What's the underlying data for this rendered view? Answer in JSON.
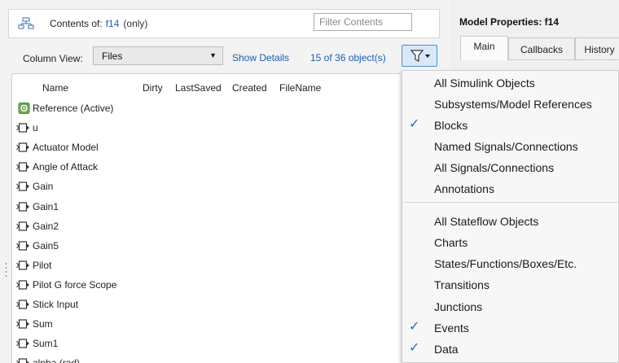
{
  "contents": {
    "label": "Contents of:",
    "model": "f14",
    "scope": "(only)",
    "filter_placeholder": "Filter Contents"
  },
  "toolbar": {
    "column_view_label": "Column View:",
    "column_view_value": "Files",
    "show_details": "Show Details",
    "object_count": "15 of 36 object(s)"
  },
  "columns": [
    "Name",
    "Dirty",
    "LastSaved",
    "Created",
    "FileName"
  ],
  "rows": [
    {
      "name": "Reference (Active)",
      "icon": "reference-icon"
    },
    {
      "name": "u",
      "icon": "block-icon"
    },
    {
      "name": "Actuator Model",
      "icon": "block-icon"
    },
    {
      "name": "Angle of  Attack",
      "icon": "block-icon"
    },
    {
      "name": "Gain",
      "icon": "block-icon"
    },
    {
      "name": "Gain1",
      "icon": "block-icon"
    },
    {
      "name": "Gain2",
      "icon": "block-icon"
    },
    {
      "name": "Gain5",
      "icon": "block-icon"
    },
    {
      "name": "Pilot",
      "icon": "block-icon"
    },
    {
      "name": "Pilot G force Scope",
      "icon": "block-icon"
    },
    {
      "name": "Stick Input",
      "icon": "block-icon"
    },
    {
      "name": "Sum",
      "icon": "block-icon"
    },
    {
      "name": "Sum1",
      "icon": "block-icon"
    },
    {
      "name": "alpha (rad)",
      "icon": "block-icon"
    }
  ],
  "properties": {
    "title": "Model Properties: f14",
    "tabs": [
      "Main",
      "Callbacks",
      "History"
    ]
  },
  "filter_menu": {
    "items": [
      {
        "label": "All Simulink Objects",
        "checked": false
      },
      {
        "label": "Subsystems/Model References",
        "checked": false
      },
      {
        "label": "Blocks",
        "checked": true
      },
      {
        "label": "Named Signals/Connections",
        "checked": false
      },
      {
        "label": "All Signals/Connections",
        "checked": false
      },
      {
        "label": "Annotations",
        "checked": false
      },
      {
        "label": "All Stateflow Objects",
        "checked": false
      },
      {
        "label": "Charts",
        "checked": false
      },
      {
        "label": "States/Functions/Boxes/Etc.",
        "checked": false
      },
      {
        "label": "Transitions",
        "checked": false
      },
      {
        "label": "Junctions",
        "checked": false
      },
      {
        "label": "Events",
        "checked": true
      },
      {
        "label": "Data",
        "checked": true
      }
    ]
  },
  "colors": {
    "link": "#1a5fb4",
    "check": "#1f6fc4",
    "reference_icon": "#6aa84f"
  }
}
